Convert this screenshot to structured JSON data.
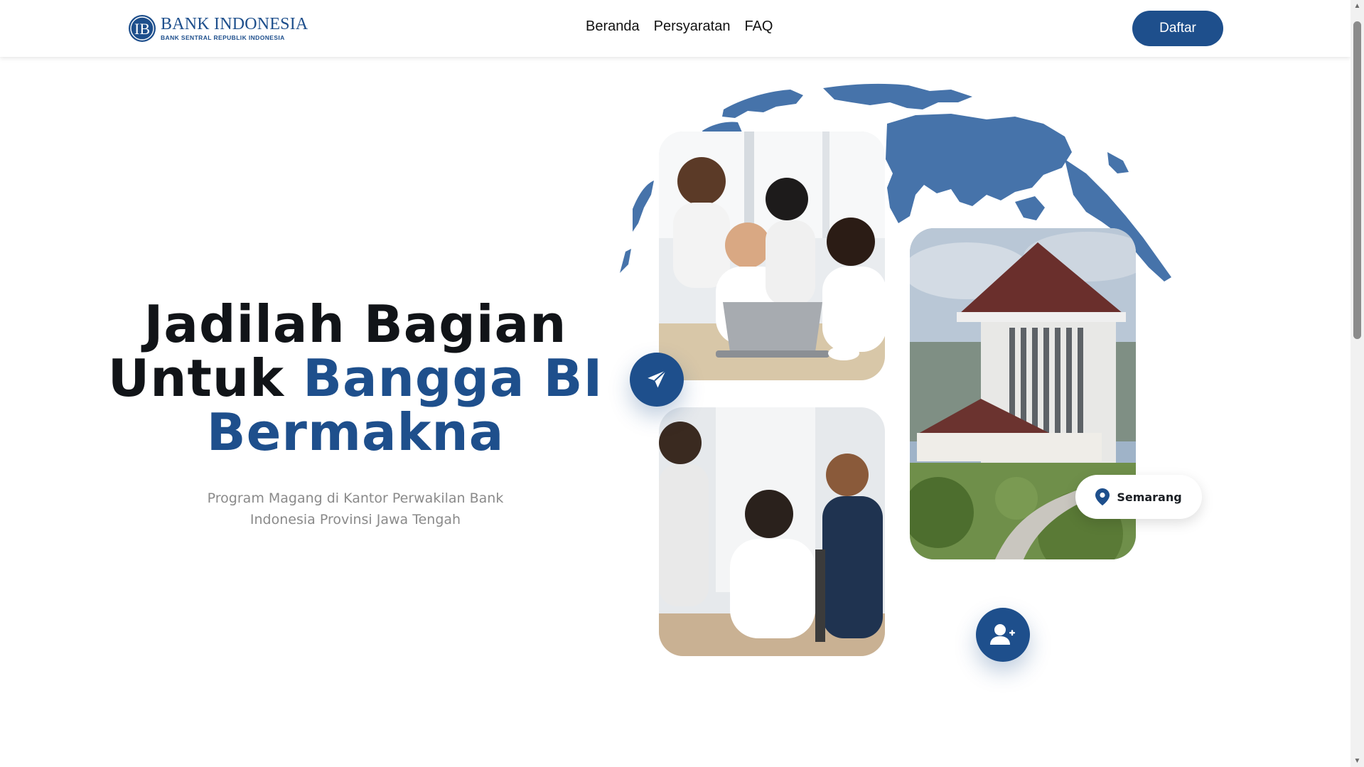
{
  "header": {
    "logo": {
      "title": "BANK INDONESIA",
      "subtitle": "BANK SENTRAL REPUBLIK INDONESIA",
      "icon": "bank-indonesia-logo-icon"
    },
    "nav": [
      {
        "label": "Beranda"
      },
      {
        "label": "Persyaratan"
      },
      {
        "label": "FAQ"
      }
    ],
    "cta_label": "Daftar"
  },
  "hero": {
    "title_line1": "Jadilah Bagian",
    "title_line2_prefix": "Untuk ",
    "title_line2_accent": "Bangga BI",
    "title_line3_accent": "Bermakna",
    "subtitle": "Program Magang di Kantor Perwakilan Bank Indonesia Provinsi Jawa Tengah",
    "location_label": "Semarang",
    "icons": {
      "send": "paper-plane-icon",
      "user": "user-plus-icon",
      "location": "map-pin-icon",
      "globe": "world-map-icon"
    }
  },
  "colors": {
    "brand": "#1e4f8c",
    "text": "#111418",
    "muted": "#8a8a8a",
    "globe": "#4673aa"
  }
}
